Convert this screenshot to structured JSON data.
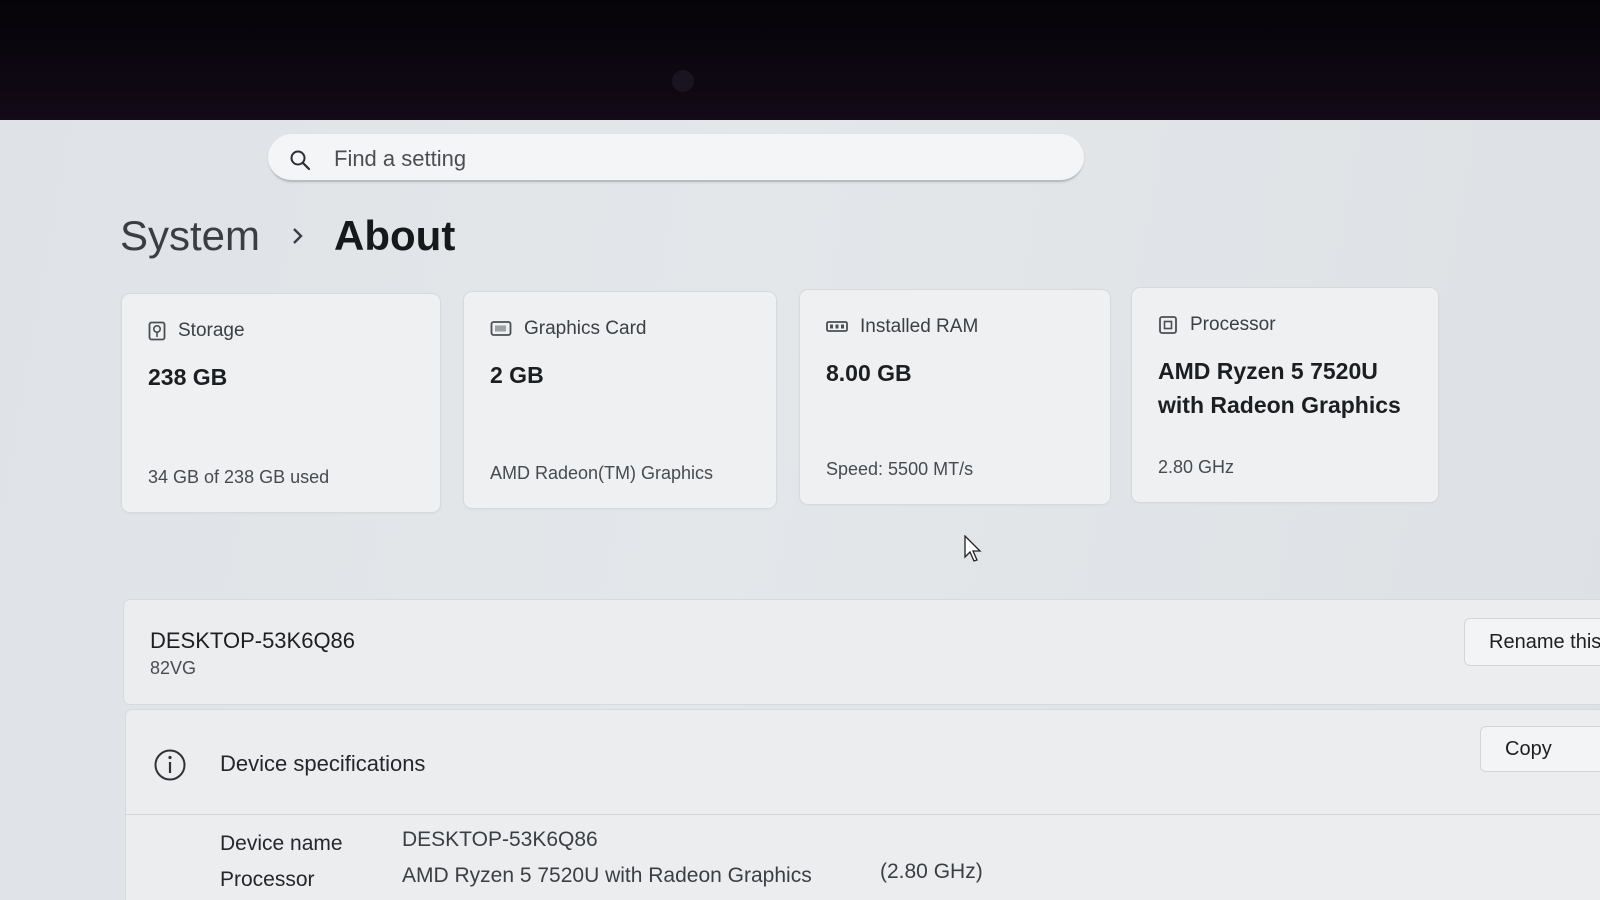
{
  "search": {
    "placeholder": "Find a setting",
    "icon": "search-icon"
  },
  "breadcrumb": {
    "parent": "System",
    "current": "About"
  },
  "cards": [
    {
      "icon": "storage-icon",
      "title": "Storage",
      "value": "238 GB",
      "detail": "34 GB of 238 GB used"
    },
    {
      "icon": "graphics-card-icon",
      "title": "Graphics Card",
      "value": "2 GB",
      "detail": "AMD Radeon(TM) Graphics"
    },
    {
      "icon": "ram-icon",
      "title": "Installed RAM",
      "value": "8.00 GB",
      "detail": "Speed: 5500 MT/s"
    },
    {
      "icon": "processor-icon",
      "title": "Processor",
      "value_line1": "AMD Ryzen 5 7520U",
      "value_line2": "with Radeon Graphics",
      "detail": "2.80 GHz"
    }
  ],
  "device": {
    "name": "DESKTOP-53K6Q86",
    "model": "82VG",
    "rename_label": "Rename this"
  },
  "specs": {
    "title": "Device specifications",
    "copy_label": "Copy",
    "rows": [
      {
        "label": "Device name",
        "value": "DESKTOP-53K6Q86"
      },
      {
        "label": "Processor",
        "value": "AMD Ryzen 5 7520U with Radeon Graphics",
        "extra": "(2.80 GHz)"
      }
    ]
  },
  "colors": {
    "background": "#e1e5e8",
    "card": "#eef0f2",
    "text": "#1c1f22"
  }
}
